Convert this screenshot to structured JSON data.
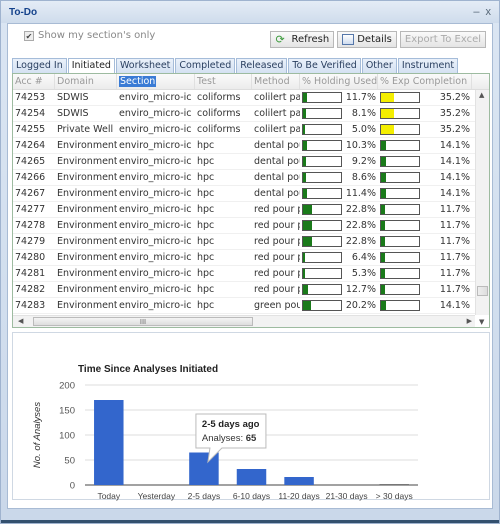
{
  "window": {
    "title": "To-Do",
    "controls": [
      "–",
      "x"
    ]
  },
  "filters": {
    "show_my_section_only_label": "Show my section's only",
    "show_my_section_only_checked": true
  },
  "toolbar": {
    "refresh_label": "Refresh",
    "details_label": "Details",
    "export_label": "Export To Excel"
  },
  "tabs": [
    {
      "label": "Logged In",
      "active": false
    },
    {
      "label": "Initiated",
      "active": true
    },
    {
      "label": "Worksheet",
      "active": false
    },
    {
      "label": "Completed",
      "active": false
    },
    {
      "label": "Released",
      "active": false
    },
    {
      "label": "To Be Verified",
      "active": false
    },
    {
      "label": "Other",
      "active": false
    },
    {
      "label": "Instrument",
      "active": false
    }
  ],
  "grid": {
    "columns": [
      "Acc #",
      "Domain",
      "Section",
      "Test",
      "Method",
      "% Holding Used",
      "% Exp Completion"
    ],
    "selected_column": "Section",
    "hscroll_grip": "III",
    "rows": [
      {
        "acc": "74253",
        "domain": "SDWIS",
        "section": "enviro_micro-ic",
        "test": "coliforms",
        "method": "colilert pa",
        "holding_pct": 11.7,
        "holding_label": "11.7%",
        "exp_pct": 35.2,
        "exp_label": "35.2%",
        "exp_color": "yellow"
      },
      {
        "acc": "74254",
        "domain": "SDWIS",
        "section": "enviro_micro-ic",
        "test": "coliforms",
        "method": "colilert pa",
        "holding_pct": 8.1,
        "holding_label": "8.1%",
        "exp_pct": 35.2,
        "exp_label": "35.2%",
        "exp_color": "yellow"
      },
      {
        "acc": "74255",
        "domain": "Private Well",
        "section": "enviro_micro-ic",
        "test": "coliforms",
        "method": "colilert pa",
        "holding_pct": 5.0,
        "holding_label": "5.0%",
        "exp_pct": 35.2,
        "exp_label": "35.2%",
        "exp_color": "yellow"
      },
      {
        "acc": "74264",
        "domain": "Environmental",
        "section": "enviro_micro-ic",
        "test": "hpc",
        "method": "dental pou",
        "holding_pct": 10.3,
        "holding_label": "10.3%",
        "exp_pct": 14.1,
        "exp_label": "14.1%",
        "exp_color": "green"
      },
      {
        "acc": "74265",
        "domain": "Environmental",
        "section": "enviro_micro-ic",
        "test": "hpc",
        "method": "dental pou",
        "holding_pct": 9.2,
        "holding_label": "9.2%",
        "exp_pct": 14.1,
        "exp_label": "14.1%",
        "exp_color": "green"
      },
      {
        "acc": "74266",
        "domain": "Environmental",
        "section": "enviro_micro-ic",
        "test": "hpc",
        "method": "dental pou",
        "holding_pct": 8.6,
        "holding_label": "8.6%",
        "exp_pct": 14.1,
        "exp_label": "14.1%",
        "exp_color": "green"
      },
      {
        "acc": "74267",
        "domain": "Environmental",
        "section": "enviro_micro-ic",
        "test": "hpc",
        "method": "dental pou",
        "holding_pct": 11.4,
        "holding_label": "11.4%",
        "exp_pct": 14.1,
        "exp_label": "14.1%",
        "exp_color": "green"
      },
      {
        "acc": "74277",
        "domain": "Environmental",
        "section": "enviro_micro-ic",
        "test": "hpc",
        "method": "red pour p",
        "holding_pct": 22.8,
        "holding_label": "22.8%",
        "exp_pct": 11.7,
        "exp_label": "11.7%",
        "exp_color": "green"
      },
      {
        "acc": "74278",
        "domain": "Environmental",
        "section": "enviro_micro-ic",
        "test": "hpc",
        "method": "red pour p",
        "holding_pct": 22.8,
        "holding_label": "22.8%",
        "exp_pct": 11.7,
        "exp_label": "11.7%",
        "exp_color": "green"
      },
      {
        "acc": "74279",
        "domain": "Environmental",
        "section": "enviro_micro-ic",
        "test": "hpc",
        "method": "red pour p",
        "holding_pct": 22.8,
        "holding_label": "22.8%",
        "exp_pct": 11.7,
        "exp_label": "11.7%",
        "exp_color": "green"
      },
      {
        "acc": "74280",
        "domain": "Environmental",
        "section": "enviro_micro-ic",
        "test": "hpc",
        "method": "red pour p",
        "holding_pct": 6.4,
        "holding_label": "6.4%",
        "exp_pct": 11.7,
        "exp_label": "11.7%",
        "exp_color": "green"
      },
      {
        "acc": "74281",
        "domain": "Environmental",
        "section": "enviro_micro-ic",
        "test": "hpc",
        "method": "red pour p",
        "holding_pct": 5.3,
        "holding_label": "5.3%",
        "exp_pct": 11.7,
        "exp_label": "11.7%",
        "exp_color": "green"
      },
      {
        "acc": "74282",
        "domain": "Environmental",
        "section": "enviro_micro-ic",
        "test": "hpc",
        "method": "red pour p",
        "holding_pct": 12.7,
        "holding_label": "12.7%",
        "exp_pct": 11.7,
        "exp_label": "11.7%",
        "exp_color": "green"
      },
      {
        "acc": "74283",
        "domain": "Environmental",
        "section": "enviro_micro-ic",
        "test": "hpc",
        "method": "green pour",
        "holding_pct": 20.2,
        "holding_label": "20.2%",
        "exp_pct": 14.1,
        "exp_label": "14.1%",
        "exp_color": "green"
      }
    ]
  },
  "colors": {
    "bar_green": "#1a7a1a",
    "bar_yellow": "#f4ee00",
    "chart_bar": "#3366cc"
  },
  "chart_data": {
    "type": "bar",
    "title": "Time Since Analyses Initiated",
    "xlabel": "",
    "ylabel": "No. of Analyses",
    "categories": [
      "Today",
      "Yesterday",
      "2-5 days ago",
      "6-10 days ago",
      "11-20 days ago",
      "21-30 days ago",
      "> 30 days ago"
    ],
    "values": [
      170,
      0,
      65,
      32,
      16,
      0,
      1
    ],
    "yticks": [
      0,
      50,
      100,
      150,
      200
    ],
    "ylim": [
      0,
      200
    ],
    "grid": true,
    "legend": "none",
    "tooltip": {
      "category": "2-5 days ago",
      "label": "Analyses:",
      "value": "65"
    }
  }
}
